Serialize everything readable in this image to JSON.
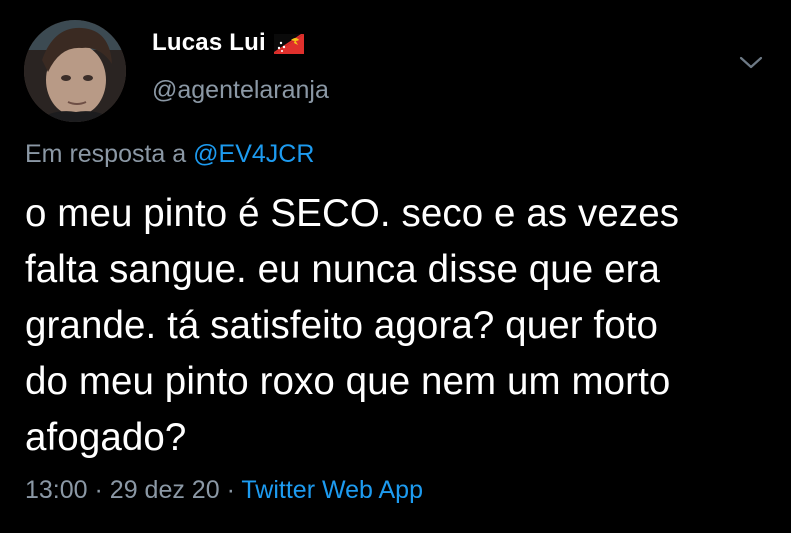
{
  "author": {
    "display_name": "Lucas Lui",
    "handle": "@agentelaranja",
    "flag_icon": "papua-new-guinea-flag-icon"
  },
  "reply": {
    "prefix": "Em resposta a",
    "mention": "@EV4JCR"
  },
  "tweet": {
    "lines": [
      "o meu pinto é SECO. seco e as vezes",
      "falta sangue. eu nunca disse que era",
      "grande. tá satisfeito agora? quer foto",
      "do meu pinto roxo que nem um morto",
      "afogado?"
    ]
  },
  "meta": {
    "time": "13:00",
    "separator": "·",
    "date": "29 dez 20",
    "source": "Twitter Web App"
  },
  "colors": {
    "background": "#000000",
    "text": "#ffffff",
    "secondary": "#8b98a5",
    "accent": "#1d9bf0"
  }
}
